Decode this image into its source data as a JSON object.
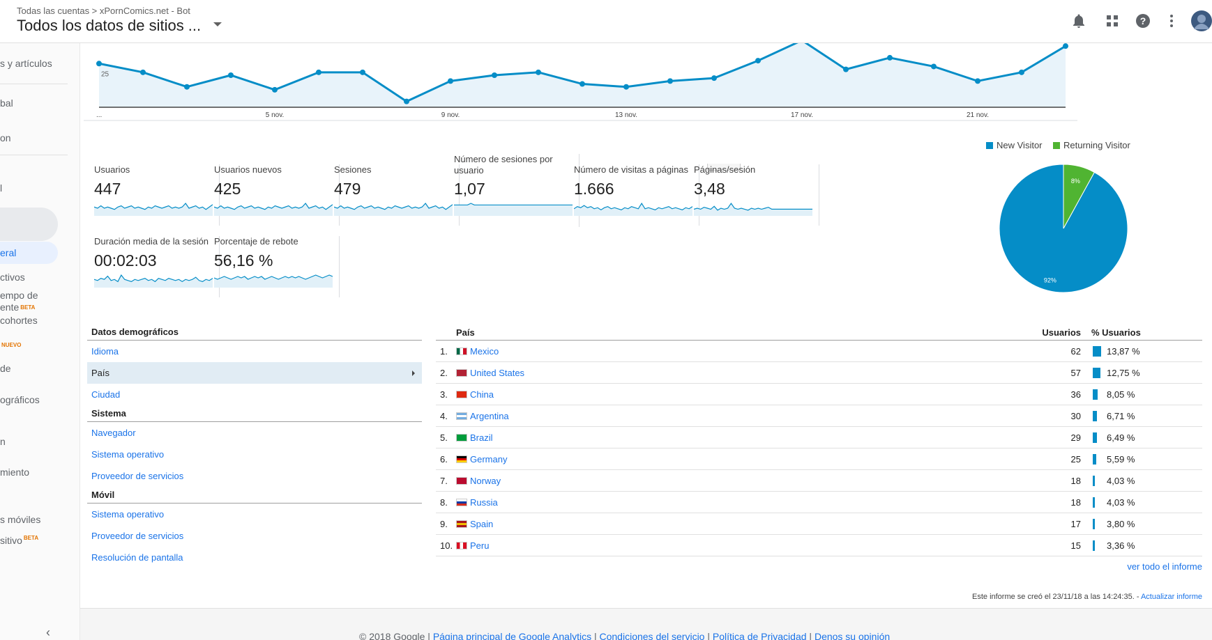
{
  "header": {
    "breadcrumb": "Todas las cuentas > xPornComics.net - Bot",
    "view_title": "Todos los datos de sitios ...",
    "icons": [
      "bell-icon",
      "apps-grid-icon",
      "help-icon",
      "more-vert-icon",
      "avatar"
    ]
  },
  "sidebar": {
    "items": [
      {
        "label": "s y artículos"
      },
      {
        "label": "bal"
      },
      {
        "label": "on"
      },
      {
        "label": "l"
      },
      {
        "label": "eral"
      },
      {
        "label": "ctivos"
      },
      {
        "label": "empo de"
      },
      {
        "label": "ente",
        "badge": "BETA"
      },
      {
        "label": "cohortes"
      },
      {
        "label": "",
        "badge": "NUEVO"
      },
      {
        "label": "de"
      },
      {
        "label": "ográficos"
      },
      {
        "label": "n"
      },
      {
        "label": "miento"
      },
      {
        "label": "s móviles"
      },
      {
        "label": "sitivo",
        "badge": "BETA"
      }
    ]
  },
  "chart_data": [
    {
      "type": "area",
      "x": [
        "1 nov.",
        "2 nov.",
        "3 nov.",
        "4 nov.",
        "5 nov.",
        "6 nov.",
        "7 nov.",
        "8 nov.",
        "9 nov.",
        "10 nov.",
        "11 nov.",
        "12 nov.",
        "13 nov.",
        "14 nov.",
        "15 nov.",
        "16 nov.",
        "17 nov.",
        "18 nov.",
        "19 nov.",
        "20 nov.",
        "21 nov.",
        "22 nov.",
        "23 nov."
      ],
      "values": [
        25,
        22,
        17,
        21,
        16,
        22,
        22,
        12,
        19,
        21,
        22,
        18,
        17,
        19,
        20,
        26,
        34,
        23,
        27,
        24,
        19,
        22,
        31
      ],
      "tick_labels": [
        "...",
        "5 nov.",
        "9 nov.",
        "13 nov.",
        "17 nov.",
        "21 nov."
      ],
      "y_tick": "25",
      "color": "#058dc7"
    },
    {
      "type": "pie",
      "categories": [
        "New Visitor",
        "Returning Visitor"
      ],
      "values": [
        92,
        8
      ],
      "slice_labels": [
        "92%",
        "8%"
      ],
      "colors": [
        "#058dc7",
        "#50b432"
      ],
      "legend": "top"
    }
  ],
  "metrics": [
    {
      "label": "Usuarios",
      "value": "447",
      "spark": [
        5,
        4,
        6,
        4,
        5,
        4,
        3,
        5,
        6,
        4,
        5,
        6,
        4,
        5,
        4,
        3,
        5,
        4,
        6,
        5,
        4,
        5,
        6,
        4,
        5,
        4,
        5,
        8,
        4,
        5,
        6,
        4,
        5,
        3,
        5,
        7
      ]
    },
    {
      "label": "Usuarios nuevos",
      "value": "425",
      "spark": [
        5,
        4,
        6,
        4,
        5,
        4,
        3,
        5,
        6,
        4,
        5,
        6,
        4,
        5,
        4,
        3,
        5,
        4,
        6,
        5,
        4,
        5,
        6,
        4,
        5,
        4,
        5,
        8,
        4,
        5,
        6,
        4,
        5,
        3,
        5,
        7
      ]
    },
    {
      "label": "Sesiones",
      "value": "479",
      "spark": [
        5,
        4,
        6,
        4,
        5,
        4,
        3,
        5,
        6,
        4,
        5,
        6,
        4,
        5,
        4,
        3,
        5,
        4,
        6,
        5,
        4,
        5,
        6,
        4,
        5,
        4,
        5,
        8,
        4,
        5,
        6,
        4,
        5,
        3,
        5,
        7
      ]
    },
    {
      "label": "Número de sesiones por usuario",
      "value": "1,07",
      "spark": [
        5,
        5,
        5,
        5,
        5,
        6,
        5,
        5,
        5,
        5,
        5,
        5,
        5,
        5,
        5,
        5,
        5,
        5,
        5,
        5,
        5,
        5,
        5,
        5,
        5,
        5,
        5,
        5,
        5,
        5,
        5,
        5,
        5,
        5,
        5,
        5
      ]
    },
    {
      "label": "Número de visitas a páginas",
      "value": "1.666",
      "spark": [
        4,
        6,
        5,
        7,
        5,
        6,
        4,
        5,
        3,
        5,
        6,
        4,
        5,
        4,
        3,
        5,
        4,
        6,
        5,
        4,
        9,
        4,
        5,
        4,
        3,
        5,
        4,
        5,
        6,
        4,
        5,
        4,
        3,
        5,
        4,
        6
      ]
    },
    {
      "label": "Páginas/sesión",
      "value": "3,48",
      "spark": [
        4,
        5,
        4,
        6,
        5,
        4,
        7,
        3,
        5,
        4,
        5,
        10,
        5,
        4,
        5,
        4,
        3,
        5,
        4,
        5,
        4,
        5,
        6,
        4,
        4,
        4,
        4,
        4,
        4,
        4,
        4,
        4,
        4,
        4,
        4,
        4
      ]
    },
    {
      "label": "Duración media de la sesión",
      "value": "00:02:03",
      "spark": [
        5,
        4,
        6,
        5,
        8,
        4,
        5,
        3,
        9,
        5,
        4,
        3,
        5,
        4,
        5,
        6,
        4,
        5,
        3,
        6,
        5,
        4,
        6,
        5,
        4,
        5,
        3,
        5,
        4,
        5,
        7,
        4,
        3,
        5,
        4,
        6
      ]
    },
    {
      "label": "Porcentaje de rebote",
      "value": "56,16 %",
      "spark": [
        5,
        4,
        5,
        6,
        5,
        4,
        5,
        6,
        5,
        6,
        4,
        5,
        6,
        5,
        6,
        4,
        5,
        6,
        5,
        4,
        5,
        6,
        5,
        6,
        5,
        6,
        5,
        4,
        5,
        6,
        7,
        6,
        5,
        6,
        7,
        6
      ]
    }
  ],
  "demographics": {
    "sections": [
      {
        "title": "Datos demográficos",
        "links": [
          "Idioma",
          "País",
          "Ciudad"
        ]
      },
      {
        "title": "Sistema",
        "links": [
          "Navegador",
          "Sistema operativo",
          "Proveedor de servicios"
        ]
      },
      {
        "title": "Móvil",
        "links": [
          "Sistema operativo",
          "Proveedor de servicios",
          "Resolución de pantalla"
        ]
      }
    ],
    "selected": "País"
  },
  "country_table": {
    "headers": [
      "País",
      "Usuarios",
      "% Usuarios"
    ],
    "rows": [
      {
        "rank": "1.",
        "country": "Mexico",
        "users": "62",
        "pct": "13,87 %",
        "frac": 0.1387,
        "flag": "mx"
      },
      {
        "rank": "2.",
        "country": "United States",
        "users": "57",
        "pct": "12,75 %",
        "frac": 0.1275,
        "flag": "us"
      },
      {
        "rank": "3.",
        "country": "China",
        "users": "36",
        "pct": "8,05 %",
        "frac": 0.0805,
        "flag": "cn"
      },
      {
        "rank": "4.",
        "country": "Argentina",
        "users": "30",
        "pct": "6,71 %",
        "frac": 0.0671,
        "flag": "ar"
      },
      {
        "rank": "5.",
        "country": "Brazil",
        "users": "29",
        "pct": "6,49 %",
        "frac": 0.0649,
        "flag": "br"
      },
      {
        "rank": "6.",
        "country": "Germany",
        "users": "25",
        "pct": "5,59 %",
        "frac": 0.0559,
        "flag": "de"
      },
      {
        "rank": "7.",
        "country": "Norway",
        "users": "18",
        "pct": "4,03 %",
        "frac": 0.0403,
        "flag": "no"
      },
      {
        "rank": "8.",
        "country": "Russia",
        "users": "18",
        "pct": "4,03 %",
        "frac": 0.0403,
        "flag": "ru"
      },
      {
        "rank": "9.",
        "country": "Spain",
        "users": "17",
        "pct": "3,80 %",
        "frac": 0.038,
        "flag": "es"
      },
      {
        "rank": "10.",
        "country": "Peru",
        "users": "15",
        "pct": "3,36 %",
        "frac": 0.0336,
        "flag": "pe"
      }
    ],
    "full_report_link": "ver todo el informe"
  },
  "report_note": {
    "text": "Este informe se creó el 23/11/18 a las 14:24:35. - ",
    "link": "Actualizar informe"
  },
  "footer": {
    "copyright": "© 2018 Google",
    "links": [
      "Página principal de Google Analytics",
      "Condiciones del servicio",
      "Política de Privacidad",
      "Denos su opinión"
    ]
  }
}
